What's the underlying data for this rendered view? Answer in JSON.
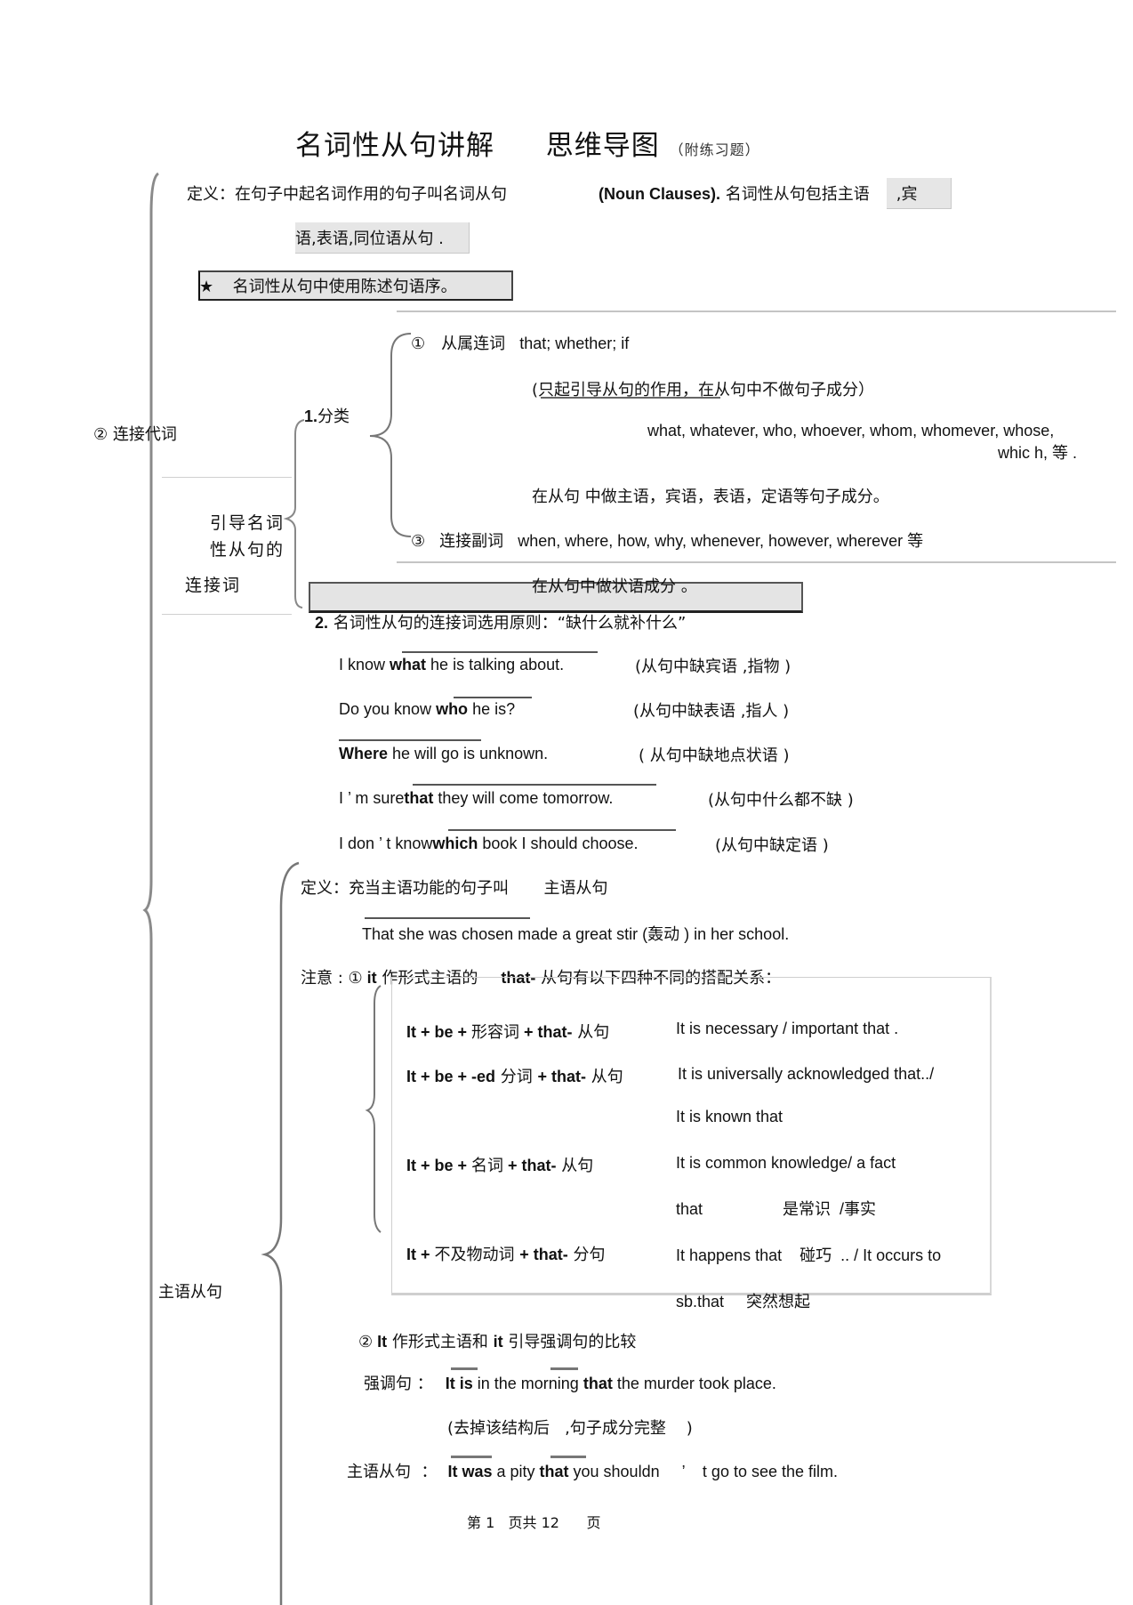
{
  "document": {
    "title_main": "名词性从句讲解",
    "title_mindmap": "思维导图",
    "title_note": "（附练习题）",
    "definition": {
      "prefix": "定义：在句子中起名词作用的句子叫名词从句",
      "english": "(Noun Clauses).",
      "suffix": " 名词性从句包括主语",
      "highlight_end": ",宾",
      "line2": "语,表语,同位语从句 ."
    },
    "star_note": {
      "icon": "★",
      "text": "名词性从句中使用陈述句语序。"
    },
    "connectives": {
      "branch_label": "② 连接代词",
      "side_label_lines": [
        "引导名词",
        "性从句的",
        "连接词"
      ],
      "classification_label_num": "1.",
      "classification_label_text": "分类",
      "subordinating": {
        "marker": "①",
        "label": "从属连词",
        "words": "that; whether; if",
        "note": "(只起引导从句的作用，在从句中不做句子成分）"
      },
      "pronouns": {
        "words_line1": "what, whatever, who, whoever, whom, whomever, whose,",
        "words_line2": "whic  h, 等 .",
        "note": "在从句    中做主语，宾语，表语，定语等句子成分。"
      },
      "adverbs": {
        "marker": "③",
        "label": "连接副词",
        "words": "when, where, how, why, whenever, however, wherever 等",
        "note": "在从句中做状语成分     。"
      }
    },
    "principle": {
      "num": "2.",
      "text": " 名词性从句的连接词选用原则：“缺什么就补什么”",
      "examples": [
        {
          "pre": "I know ",
          "bold": "what",
          "post": " he is talking about.",
          "note": "(从句中缺宾语  ,指物 )"
        },
        {
          "pre": "Do you know ",
          "bold": "who",
          "post": " he is?",
          "note": "(从句中缺表语  ,指人 )"
        },
        {
          "pre": "",
          "bold": "Where",
          "post": " he will go is unknown.",
          "note": "( 从句中缺地点状语  )"
        },
        {
          "pre": "I ’   m sure",
          "bold": "that",
          "post": " they will come tomorrow.",
          "note": "(从句中什么都不缺  )"
        },
        {
          "pre": "I don  ’   t know",
          "bold": "which",
          "post": " book I should choose.",
          "note": "(从句中缺定语  )"
        }
      ]
    },
    "subject_clause": {
      "label": "主语从句",
      "definition_prefix": "定义：充当主语功能的句子叫",
      "definition_term": "主语从句",
      "example": "That she was chosen made a great stir (轰动 ) in her school.",
      "note1": {
        "prefix": "注意 : ①",
        "it": " it",
        "mid": " 作形式主语的",
        "that": "that-",
        "suffix": " 从句有以下四种不同的搭配关系："
      },
      "patterns": [
        {
          "formula_parts": [
            "It + be + ",
            "形容词",
            " + that-",
            " 从句"
          ],
          "example_lines": [
            "It is necessary / important that        ."
          ]
        },
        {
          "formula_parts": [
            "It + be + -ed",
            "   分词 ",
            " + that-",
            "  从句"
          ],
          "example_lines": [
            "It is universally acknowledged that../",
            "It is known that"
          ]
        },
        {
          "formula_parts": [
            "It + be + ",
            "名词",
            " + that-",
            " 从句"
          ],
          "example_lines": [
            "It is common knowledge/ a fact",
            "that                  是常识  /事实"
          ]
        },
        {
          "formula_parts": [
            "It + ",
            "不及物动词 ",
            " + that-",
            " 分句"
          ],
          "example_lines": [
            "It happens that    碰巧  .. / It occurs to",
            "sb.that     突然想起"
          ]
        }
      ],
      "note2": {
        "prefix": "②",
        "it1": " It",
        "mid": "  作形式主语和 ",
        "it2": "   it",
        "suffix": " 引导强调句的比较"
      },
      "emphasis": {
        "label": "强调句  ：",
        "b1": "It is",
        "mid": " in the morning ",
        "b2": "that",
        "post": " the murder took place.",
        "note": "(去掉该结构后   ,句子成分完整    )"
      },
      "subject_example": {
        "label": "主语从句  ：",
        "b1": "It was",
        "mid": " a pity ",
        "b2": "that",
        "post": " you shouldn     ’    t go to see the film."
      }
    },
    "footer": {
      "text": "第 1   页共 12      页"
    }
  }
}
